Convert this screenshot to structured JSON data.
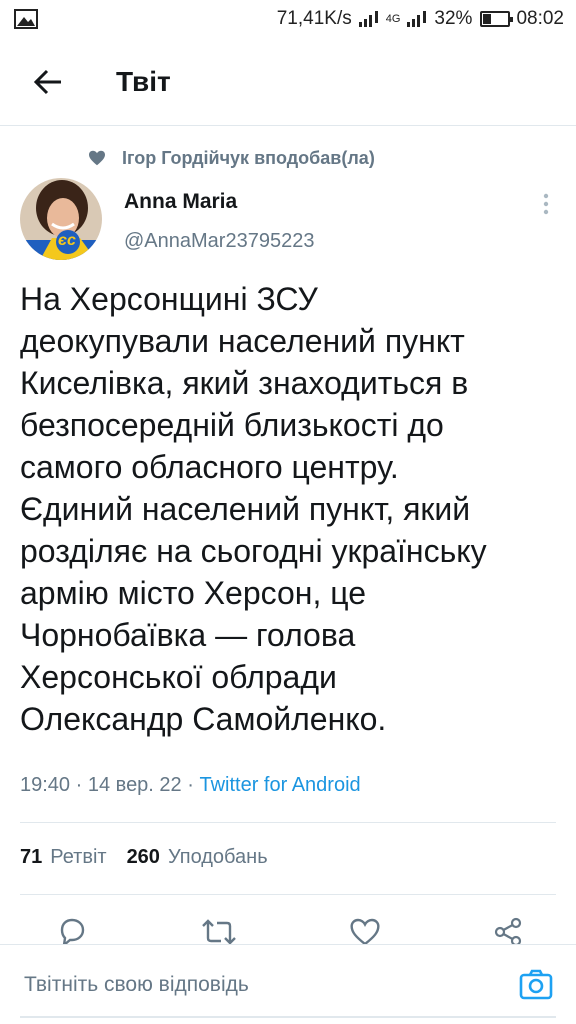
{
  "status_bar": {
    "speed": "71,41K/s",
    "network": "4G",
    "battery_percent": "32%",
    "battery_level": 0.32,
    "time": "08:02"
  },
  "app_bar": {
    "title": "Твіт"
  },
  "social_context": {
    "text": "Ігор Гордійчук вподобав(ла)"
  },
  "author": {
    "name": "Anna Maria",
    "handle": "@AnnaMar23795223",
    "avatar_badge": "єс"
  },
  "tweet": {
    "text": "На Херсонщині ЗСУ\nдеокупували населений пункт\nКиселівка, який знаходиться в\nбезпосередній близькості до\nсамого обласного центру.\nЄдиний населений пункт, який\nрозділяє на сьогодні українську\nармію місто Херсон, це\nЧорнобаївка — голова\nХерсонської облради\nОлександр Самойленко."
  },
  "meta": {
    "time": "19:40",
    "date": "14 вер. 22",
    "separator": "·",
    "client": "Twitter for Android"
  },
  "stats": {
    "retweets_count": "71",
    "retweets_label": "Ретвіт",
    "likes_count": "260",
    "likes_label": "Уподобань"
  },
  "reply": {
    "placeholder": "Твітніть свою відповідь"
  },
  "colors": {
    "accent": "#1da1f2",
    "link": "#1b95e0",
    "secondary_text": "#657786",
    "divider": "#e1e8ed"
  },
  "icons": {
    "back": "arrow-left-icon",
    "heart_small": "heart-filled-icon",
    "more": "more-vertical-icon",
    "reply": "reply-icon",
    "retweet": "retweet-icon",
    "like": "heart-icon",
    "share": "share-icon",
    "camera": "camera-icon"
  }
}
